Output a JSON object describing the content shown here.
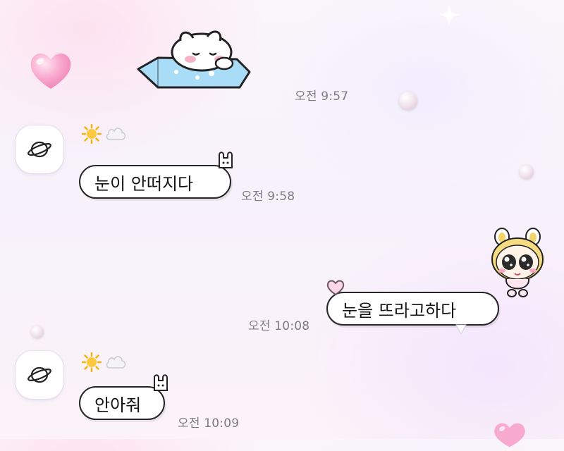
{
  "messages": [
    {
      "type": "sticker",
      "direction": "outgoing",
      "time": "오전 9:57"
    },
    {
      "type": "text",
      "direction": "incoming",
      "text": "눈이 안떠지다",
      "time": "오전 9:58"
    },
    {
      "type": "text",
      "direction": "outgoing",
      "text": "눈을 뜨라고하다",
      "time": "오전 10:08"
    },
    {
      "type": "text",
      "direction": "incoming",
      "text": "안아줘",
      "time": "오전 10:09"
    }
  ],
  "icons": {
    "avatar": "planet-icon",
    "status_1": "sun-icon",
    "status_2": "cloud-icon",
    "bubble_deco_incoming": "bunny-ears-icon",
    "bubble_deco_outgoing": "heart-icon"
  },
  "theme": {
    "bubble_border": "#262626",
    "timestamp_color": "#7c7c82",
    "heart_color": "#f7a9cf"
  }
}
